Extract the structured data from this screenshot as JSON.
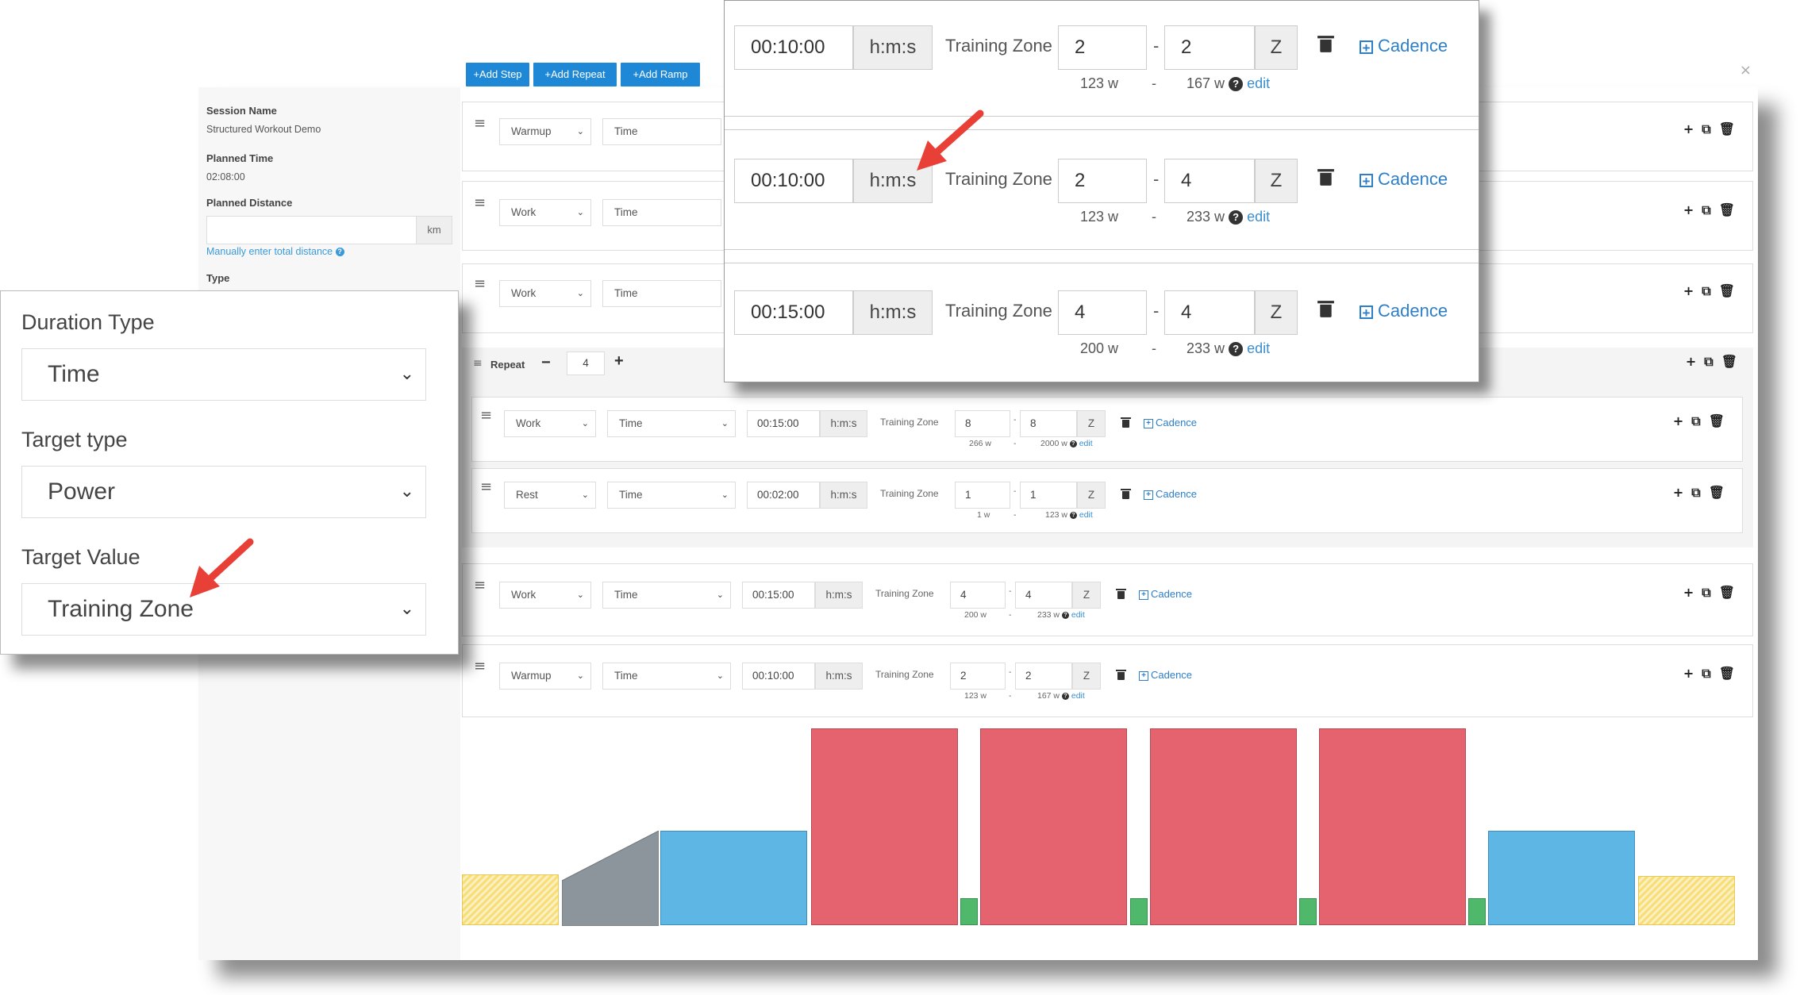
{
  "toolbar": {
    "add_step": "Add Step",
    "add_repeat": "Add Repeat",
    "add_ramp": "Add Ramp"
  },
  "session": {
    "name_label": "Session Name",
    "name_value": "Structured Workout Demo",
    "planned_time_label": "Planned Time",
    "planned_time_value": "02:08:00",
    "planned_distance_label": "Planned Distance",
    "distance_unit": "km",
    "manual_hint": "Manually enter total distance",
    "type_label": "Type"
  },
  "steps_top": [
    {
      "type": "Warmup",
      "duration_type": "Time"
    },
    {
      "type": "Work",
      "duration_type": "Time"
    },
    {
      "type": "Work",
      "duration_type": "Time"
    }
  ],
  "repeat": {
    "label": "Repeat",
    "count": "4"
  },
  "steps_inner": [
    {
      "type": "Work",
      "duration_type": "Time",
      "duration": "00:15:00",
      "unit": "h:m:s",
      "target_label": "Training Zone",
      "zone_low": "8",
      "zone_high": "8",
      "z": "Z",
      "watts_low": "266 w",
      "watts_high": "2000 w",
      "edit": "edit",
      "cadence": "Cadence"
    },
    {
      "type": "Rest",
      "duration_type": "Time",
      "duration": "00:02:00",
      "unit": "h:m:s",
      "target_label": "Training Zone",
      "zone_low": "1",
      "zone_high": "1",
      "z": "Z",
      "watts_low": "1 w",
      "watts_high": "123 w",
      "edit": "edit",
      "cadence": "Cadence"
    }
  ],
  "steps_bottom": [
    {
      "type": "Work",
      "duration_type": "Time",
      "duration": "00:15:00",
      "unit": "h:m:s",
      "target_label": "Training Zone",
      "zone_low": "4",
      "zone_high": "4",
      "z": "Z",
      "watts_low": "200 w",
      "watts_high": "233 w",
      "edit": "edit",
      "cadence": "Cadence"
    },
    {
      "type": "Warmup",
      "duration_type": "Time",
      "duration": "00:10:00",
      "unit": "h:m:s",
      "target_label": "Training Zone",
      "zone_low": "2",
      "zone_high": "2",
      "z": "Z",
      "watts_low": "123 w",
      "watts_high": "167 w",
      "edit": "edit",
      "cadence": "Cadence"
    }
  ],
  "zoom_popup": [
    {
      "duration": "00:10:00",
      "unit": "h:m:s",
      "target_label": "Training Zone",
      "zone_low": "2",
      "zone_high": "2",
      "z": "Z",
      "watts_low": "123 w",
      "dash": "-",
      "watts_high": "167 w",
      "edit": "edit",
      "cadence": "Cadence"
    },
    {
      "duration": "00:10:00",
      "unit": "h:m:s",
      "target_label": "Training Zone",
      "zone_low": "2",
      "zone_high": "4",
      "z": "Z",
      "watts_low": "123 w",
      "dash": "-",
      "watts_high": "233 w",
      "edit": "edit",
      "cadence": "Cadence"
    },
    {
      "duration": "00:15:00",
      "unit": "h:m:s",
      "target_label": "Training Zone",
      "zone_low": "4",
      "zone_high": "4",
      "z": "Z",
      "watts_low": "200 w",
      "dash": "-",
      "watts_high": "233 w",
      "edit": "edit",
      "cadence": "Cadence"
    }
  ],
  "settings_popup": {
    "duration_type_label": "Duration Type",
    "duration_type_value": "Time",
    "target_type_label": "Target type",
    "target_type_value": "Power",
    "target_value_label": "Target Value",
    "target_value_value": "Training Zone"
  },
  "colors": {
    "accent": "#1e88d6",
    "work": "#e5636e",
    "recovery": "#5db6e3",
    "rest": "#4fb86b",
    "ramp": "#8c959c",
    "warmup": "#f7de7a",
    "arrow": "#e84037"
  }
}
